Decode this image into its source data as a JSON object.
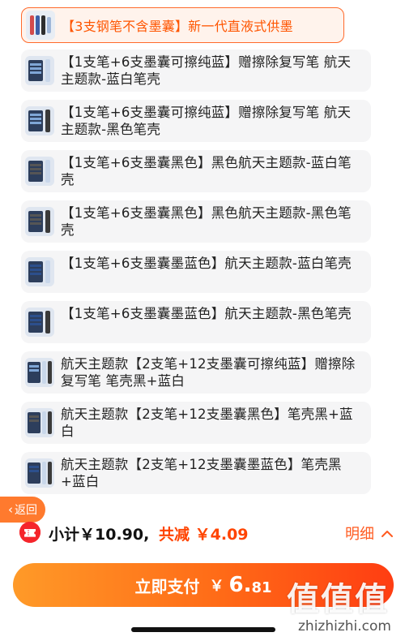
{
  "sku_options": [
    {
      "label": "【3支钢笔不含墨囊】新一代直液式供墨",
      "selected": true
    },
    {
      "label": "【1支笔+6支墨囊可擦纯蓝】赠擦除复写笔 航天主题款-蓝白笔壳",
      "selected": false
    },
    {
      "label": "【1支笔+6支墨囊可擦纯蓝】赠擦除复写笔 航天主题款-黑色笔壳",
      "selected": false
    },
    {
      "label": "【1支笔+6支墨囊黑色】黑色航天主题款-蓝白笔壳",
      "selected": false
    },
    {
      "label": "【1支笔+6支墨囊黑色】黑色航天主题款-黑色笔壳",
      "selected": false
    },
    {
      "label": "【1支笔+6支墨囊墨蓝色】航天主题款-蓝白笔壳",
      "selected": false
    },
    {
      "label": "【1支笔+6支墨囊墨蓝色】航天主题款-黑色笔壳",
      "selected": false
    },
    {
      "label": "航天主题款【2支笔+12支墨囊可擦纯蓝】赠擦除复写笔 笔壳黑+蓝白",
      "selected": false
    },
    {
      "label": "航天主题款【2支笔+12支墨囊黑色】笔壳黑+蓝白",
      "selected": false
    },
    {
      "label": "航天主题款【2支笔+12支墨囊墨蓝色】笔壳黑+蓝白",
      "selected": false
    }
  ],
  "back_button": {
    "label": "返回",
    "icon": "chevron-left-icon"
  },
  "summary": {
    "subtotal_label": "小计",
    "subtotal_value": "￥10.90,",
    "saving_label": "共减",
    "saving_value": "￥4.09",
    "detail_label": "明细",
    "detail_icon": "chevron-up-icon",
    "coupon_icon": "coupon-ticket-icon"
  },
  "pay_button": {
    "label": "立即支付",
    "currency": "￥",
    "amount_int": "6.",
    "amount_dec": "81"
  },
  "watermark": {
    "glyphs": "值值值",
    "domain": "zhizhizhi.com"
  },
  "colors": {
    "accent": "#ff5a1f",
    "selected_border": "#ff6a2b",
    "saving_red": "#ff4400",
    "coupon_red": "#f5252b"
  }
}
